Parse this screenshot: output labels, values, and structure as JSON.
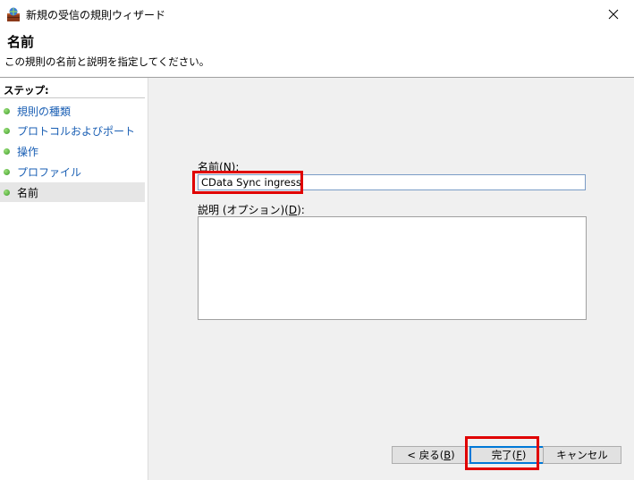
{
  "window": {
    "title": "新規の受信の規則ウィザード"
  },
  "header": {
    "title": "名前",
    "description": "この規則の名前と説明を指定してください。"
  },
  "sidebar": {
    "title": "ステップ:",
    "steps": [
      {
        "label": "規則の種類",
        "current": false
      },
      {
        "label": "プロトコルおよびポート",
        "current": false
      },
      {
        "label": "操作",
        "current": false
      },
      {
        "label": "プロファイル",
        "current": false
      },
      {
        "label": "名前",
        "current": true
      }
    ]
  },
  "form": {
    "name_label_pre": "名前(",
    "name_label_key": "N",
    "name_label_post": "):",
    "name_value": "CData Sync ingress",
    "description_label_pre": "説明 (オプション)(",
    "description_label_key": "D",
    "description_label_post": "):",
    "description_value": ""
  },
  "buttons": {
    "back_pre": "< 戻る(",
    "back_key": "B",
    "back_post": ")",
    "finish_pre": "完了(",
    "finish_key": "F",
    "finish_post": ")",
    "cancel": "キャンセル"
  },
  "colors": {
    "highlight": "#e00000",
    "link": "#1a5fb4",
    "focus": "#0078d7"
  }
}
